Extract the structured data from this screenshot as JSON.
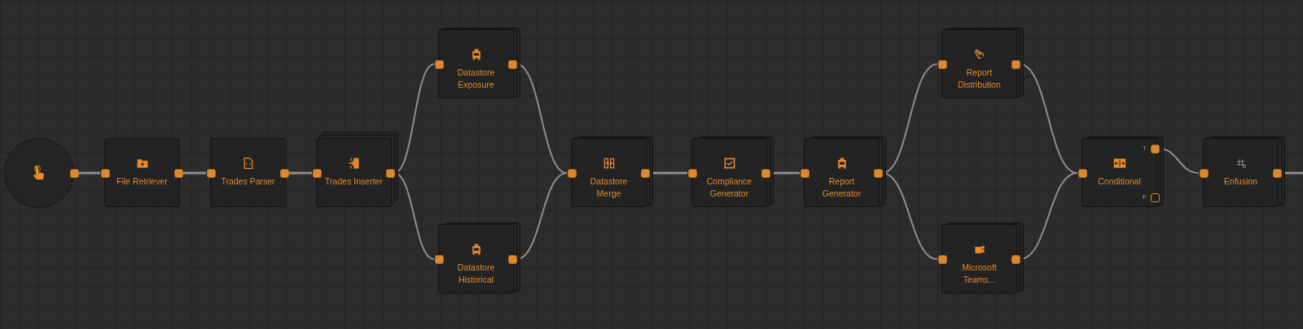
{
  "canvas": {
    "nodes": [
      {
        "kind": "start"
      },
      {
        "kind": "task",
        "label_lines": [
          "File Retriever"
        ],
        "stacked": false
      },
      {
        "kind": "task",
        "label_lines": [
          "Trades Parser"
        ],
        "stacked": false
      },
      {
        "kind": "task",
        "label_lines": [
          "Trades Inserter"
        ],
        "stacked": true
      },
      {
        "kind": "task",
        "label_lines": [
          "Datastore",
          "Exposure"
        ],
        "stacked": true
      },
      {
        "kind": "task",
        "label_lines": [
          "Datastore",
          "Historical"
        ],
        "stacked": true
      },
      {
        "kind": "task",
        "label_lines": [
          "Datastore",
          "Merge"
        ],
        "stacked": true
      },
      {
        "kind": "task",
        "label_lines": [
          "Compliance",
          "Generator"
        ],
        "stacked": true
      },
      {
        "kind": "task",
        "label_lines": [
          "Report",
          "Generator"
        ],
        "stacked": true
      },
      {
        "kind": "task",
        "label_lines": [
          "Report",
          "Distribution"
        ],
        "stacked": true
      },
      {
        "kind": "task",
        "label_lines": [
          "Microsoft",
          "Teams..."
        ],
        "stacked": true
      },
      {
        "kind": "conditional",
        "label_lines": [
          "Conditional"
        ],
        "stacked": true,
        "ports": [
          {
            "label": "T",
            "connected": true
          },
          {
            "label": "F",
            "connected": false
          }
        ]
      },
      {
        "kind": "task",
        "label_lines": [
          "Enfusion"
        ],
        "stacked": true
      }
    ]
  }
}
